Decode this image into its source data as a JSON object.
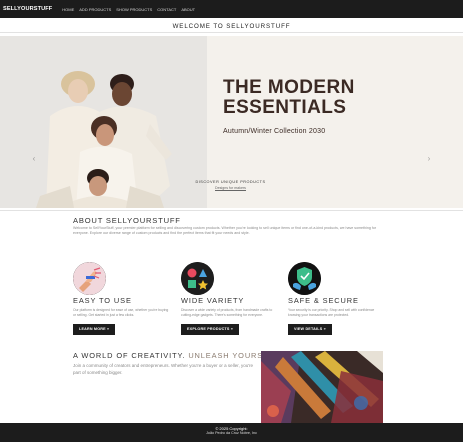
{
  "navbar": {
    "brand": "SELLYOURSTUFF",
    "links": [
      "HOME",
      "ADD PRODUCTS",
      "SHOW PRODUCTS",
      "CONTACT",
      "ABOUT"
    ]
  },
  "welcome": "WELCOME TO SELLYOURSTUFF",
  "hero": {
    "title": "THE MODERN\nESSENTIALS",
    "subtitle": "Autumn/Winter Collection 2030",
    "discover": "DISCOVER UNIQUE PRODUCTS",
    "link": "Designs for makers",
    "prev_arrow": "‹",
    "next_arrow": "›"
  },
  "about": {
    "title": "ABOUT SELLYOURSTUFF",
    "text": "Welcome to SellYourStuff, your premier platform for selling and discovering custom products. Whether you're looking to sell unique items or find one-of-a-kind products, we have something for everyone. Explore our diverse range of custom products and find the perfect items that fit your needs and style."
  },
  "features": [
    {
      "icon": "pointing-hand-icon",
      "title": "EASY TO USE",
      "text": "Our platform is designed for ease of use, whether you're buying or selling. Get started in just a few clicks.",
      "button": "LEARN MORE »"
    },
    {
      "icon": "shapes-icon",
      "title": "WIDE VARIETY",
      "text": "Discover a wide variety of products, from handmade crafts to cutting-edge gadgets. There's something for everyone.",
      "button": "EXPLORE PRODUCTS »"
    },
    {
      "icon": "shield-hands-icon",
      "title": "SAFE & SECURE",
      "text": "Your security is our priority. Shop and sell with confidence knowing your transactions are protected.",
      "button": "VIEW DETAILS »"
    }
  ],
  "creativity": {
    "title_main": "A WORLD OF CREATIVITY.",
    "title_accent": "UNLEASH YOURS.",
    "text": "Join a community of creators and entrepreneurs. Whether you're a buyer or a seller, you're part of something bigger."
  },
  "footer": {
    "copyright": "© 2025 Copyright:",
    "owner": "João Pedro da Cruz Nobre, Inc"
  },
  "colors": {
    "dark": "#1c1c1c",
    "hero_bg": "#f4f1ec",
    "hero_text": "#3b2a24",
    "accent_text": "#8a7b6f"
  }
}
